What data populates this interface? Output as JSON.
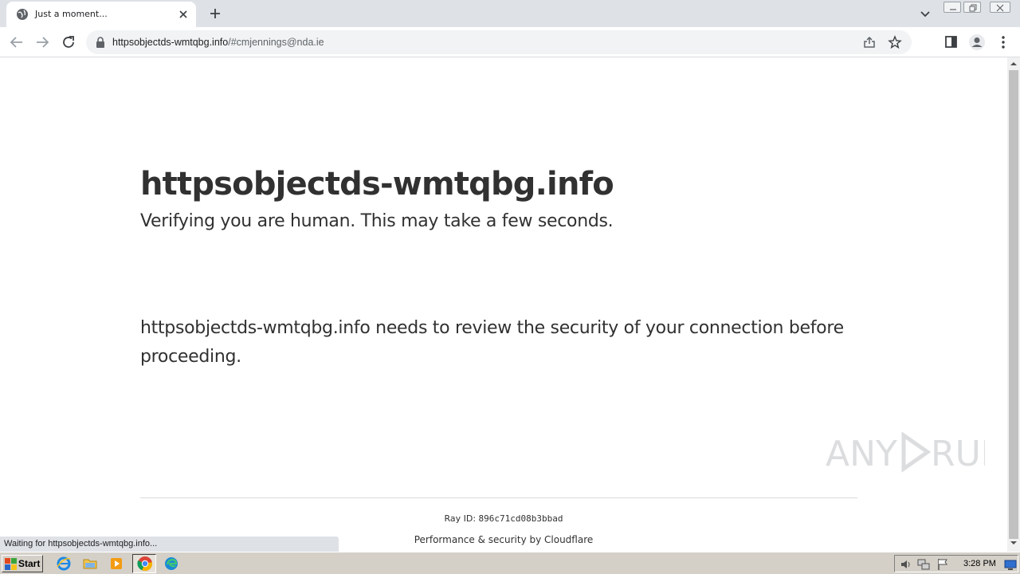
{
  "browser": {
    "tab": {
      "title": "Just a moment...",
      "favicon": "globe-icon",
      "close_icon": "close-icon"
    },
    "new_tab_icon": "plus-icon",
    "tab_search_icon": "chevron-down-icon",
    "window_controls": [
      "minimize-icon",
      "restore-icon",
      "close-icon"
    ],
    "nav": {
      "back_icon": "arrow-left-icon",
      "forward_icon": "arrow-right-icon",
      "reload_icon": "reload-icon"
    },
    "omnibox": {
      "lock_icon": "lock-icon",
      "host": "httpsobjectds-wmtqbg.info",
      "path": "/#cmjennings@nda.ie",
      "share_icon": "share-icon",
      "bookmark_icon": "star-icon"
    },
    "toolbar_right": [
      "side-panel-icon",
      "profile-icon",
      "menu-dots-icon"
    ],
    "status_text": "Waiting for httpsobjectds-wmtqbg.info..."
  },
  "page": {
    "heading": "httpsobjectds-wmtqbg.info",
    "verify_text": "Verifying you are human. This may take a few seconds.",
    "review_text": "httpsobjectds-wmtqbg.info needs to review the security of your connection before proceeding.",
    "ray_label": "Ray ID: ",
    "ray_id": "896c71cd08b3bbad",
    "footer_text": "Performance & security by Cloudflare",
    "watermark": "ANY RUN"
  },
  "taskbar": {
    "start_label": "Start",
    "quick_launch": [
      "ie-icon",
      "folder-icon",
      "media-player-icon",
      "chrome-icon",
      "edge-icon"
    ],
    "tray_icons": [
      "volume-icon",
      "network-icon",
      "flag-icon"
    ],
    "clock": "3:28 PM",
    "show_desktop_icon": "desktop-icon"
  },
  "colors": {
    "tabstrip": "#dee1e6",
    "page_text": "#313131",
    "taskbar": "#d4d0c8"
  }
}
